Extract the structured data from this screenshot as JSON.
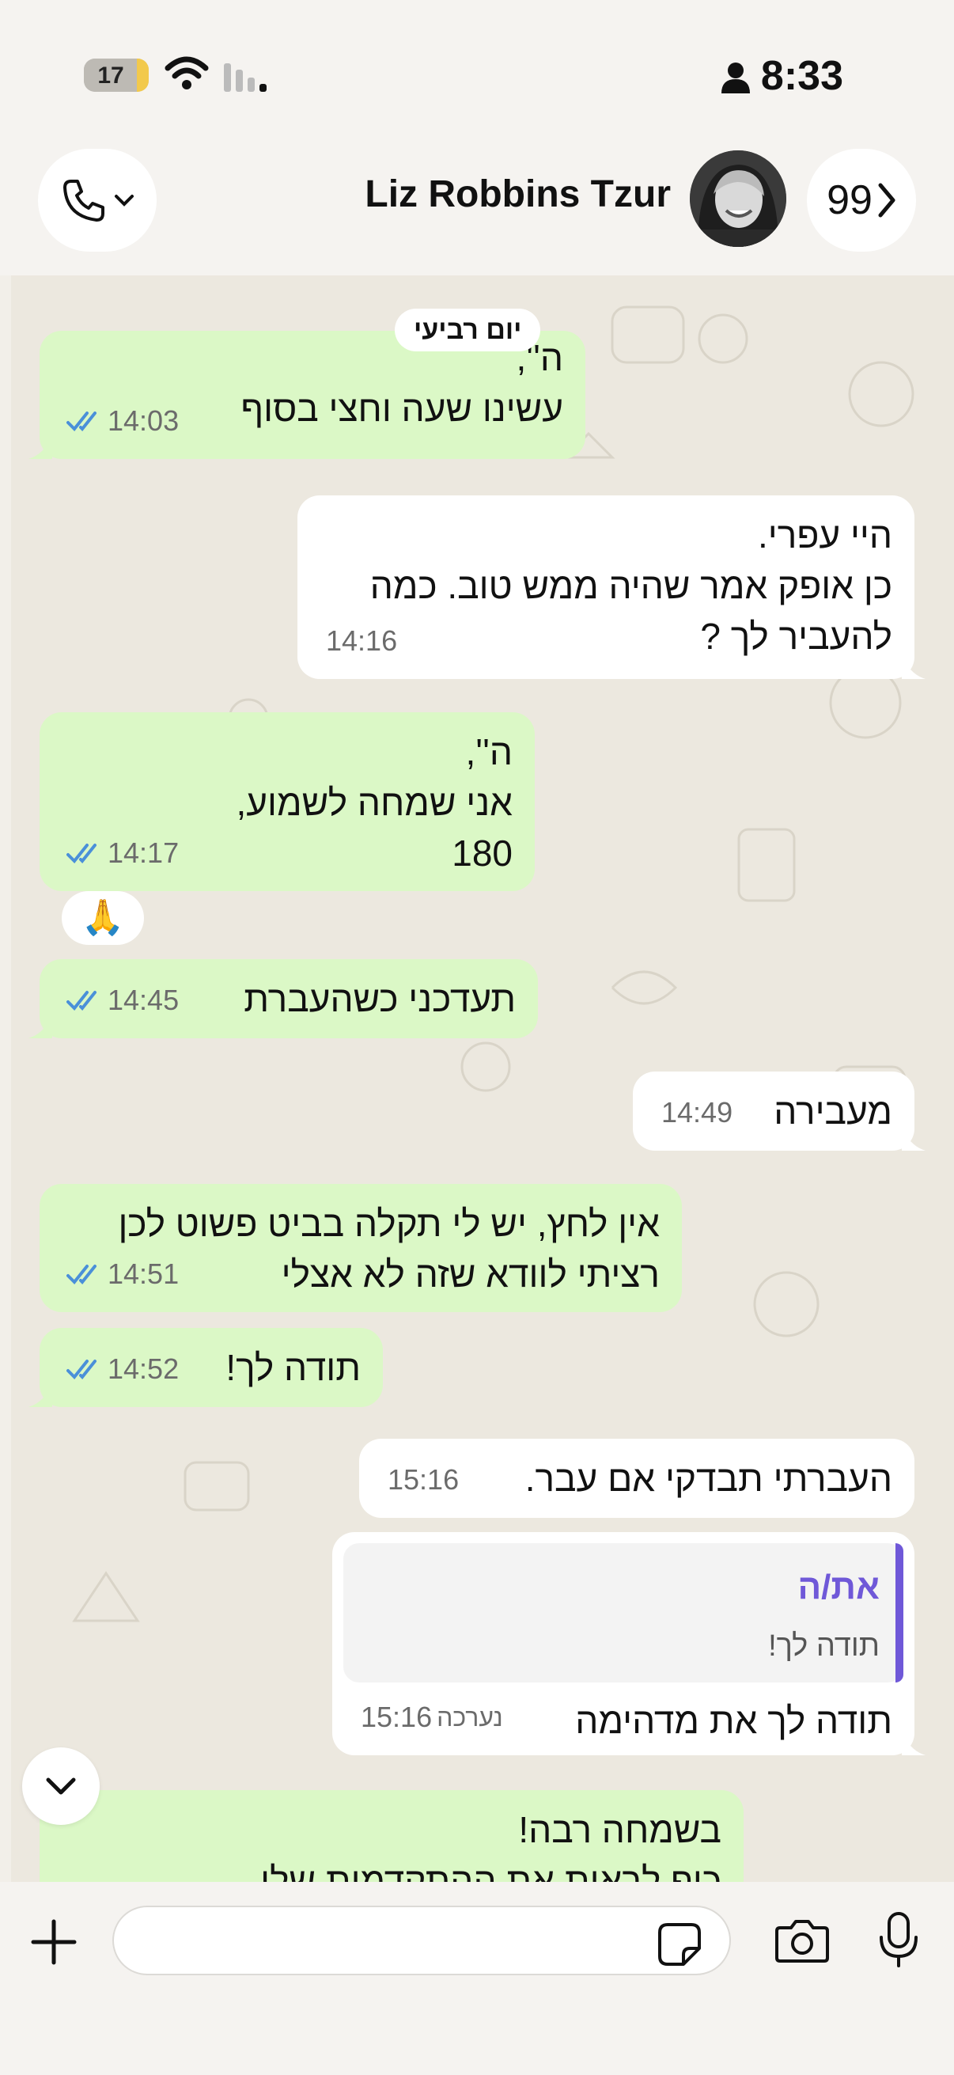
{
  "status_bar": {
    "battery": "17",
    "time": "8:33"
  },
  "header": {
    "contact_name": "Liz Robbins Tzur",
    "back_count": "99"
  },
  "chat": {
    "day_separator": "יום רביעי",
    "messages": [
      {
        "dir": "out",
        "text": "ה'',\nעשינו שעה וחצי בסוף",
        "time": "14:03"
      },
      {
        "dir": "in",
        "text": "היי עפרי.\nכן אופק אמר שהיה ממש טוב. כמה\nלהעביר לך ?",
        "time": "14:16"
      },
      {
        "dir": "out",
        "text": "ה'',\nאני שמחה לשמוע,\n180",
        "time": "14:17",
        "reaction": "🙏"
      },
      {
        "dir": "out",
        "text": "תעדכני כשהעברת",
        "time": "14:45"
      },
      {
        "dir": "in",
        "text": "מעבירה",
        "time": "14:49"
      },
      {
        "dir": "out",
        "text": "אין לחץ, יש לי תקלה בביט פשוט לכן\nרציתי לוודא שזה לא אצלי",
        "time": "14:51"
      },
      {
        "dir": "out",
        "text": "תודה לך!",
        "time": "14:52"
      },
      {
        "dir": "in",
        "text": "העברתי תבדקי אם עבר.",
        "time": "15:16"
      },
      {
        "dir": "in",
        "text": "תודה לך את מדהימה",
        "time": "15:16",
        "edited": "נערכה",
        "quote": {
          "author": "את/ה",
          "text": "תודה לך!"
        }
      },
      {
        "dir": "out",
        "text": "בשמחה רבה!\nכיף לראות את ההתקדמות שלו"
      }
    ]
  },
  "colors": {
    "outgoing": "#dbf8c6",
    "incoming": "#ffffff",
    "read_ticks": "#4a90d9",
    "quote_accent": "#6f58d8"
  },
  "composer": {
    "placeholder": ""
  }
}
